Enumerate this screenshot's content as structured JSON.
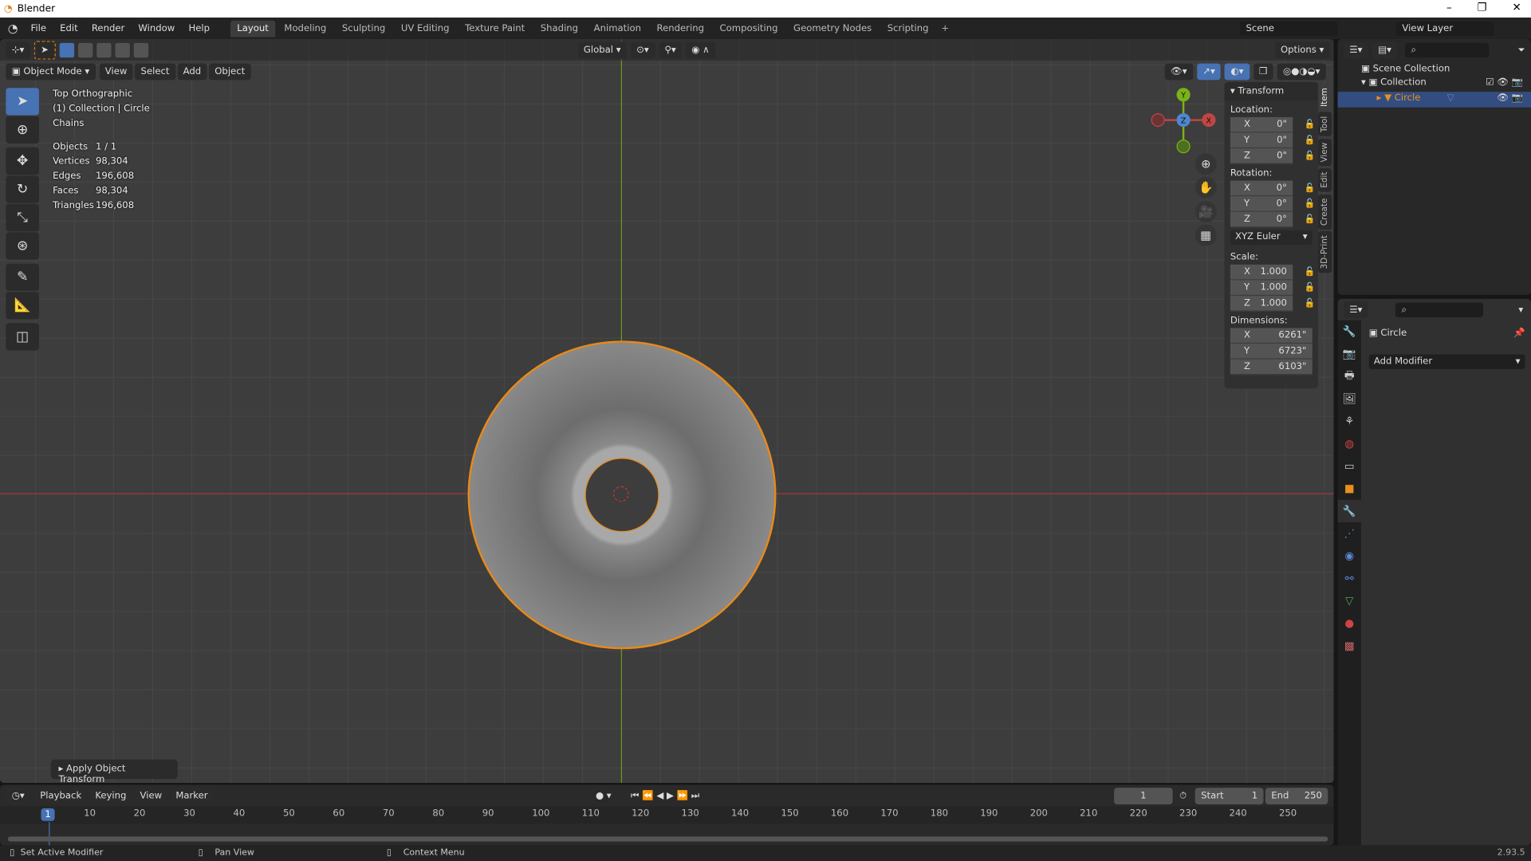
{
  "window": {
    "title": "Blender"
  },
  "menu": [
    "File",
    "Edit",
    "Render",
    "Window",
    "Help"
  ],
  "workspaces": [
    "Layout",
    "Modeling",
    "Sculpting",
    "UV Editing",
    "Texture Paint",
    "Shading",
    "Animation",
    "Rendering",
    "Compositing",
    "Geometry Nodes",
    "Scripting"
  ],
  "active_workspace": "Layout",
  "scene": "Scene",
  "view_layer": "View Layer",
  "tool_header": {
    "orientation": "Global",
    "options": "Options"
  },
  "viewport_header": {
    "mode": "Object Mode",
    "menus": [
      "View",
      "Select",
      "Add",
      "Object"
    ]
  },
  "overlay": {
    "view": "Top Orthographic",
    "collection": "(1) Collection | Circle",
    "extra": "Chains",
    "stats": [
      [
        "Objects",
        "1 / 1"
      ],
      [
        "Vertices",
        "98,304"
      ],
      [
        "Edges",
        "196,608"
      ],
      [
        "Faces",
        "98,304"
      ],
      [
        "Triangles",
        "196,608"
      ]
    ]
  },
  "gizmo": {
    "y": "Y",
    "z": "Z",
    "x": "X"
  },
  "transform": {
    "title": "Transform",
    "location_label": "Location:",
    "rotation_label": "Rotation:",
    "scale_label": "Scale:",
    "dimensions_label": "Dimensions:",
    "location": [
      [
        "X",
        "0\""
      ],
      [
        "Y",
        "0\""
      ],
      [
        "Z",
        "0\""
      ]
    ],
    "rotation": [
      [
        "X",
        "0°"
      ],
      [
        "Y",
        "0°"
      ],
      [
        "Z",
        "0°"
      ]
    ],
    "rotation_mode": "XYZ Euler",
    "scale": [
      [
        "X",
        "1.000"
      ],
      [
        "Y",
        "1.000"
      ],
      [
        "Z",
        "1.000"
      ]
    ],
    "dimensions": [
      [
        "X",
        "6261\""
      ],
      [
        "Y",
        "6723\""
      ],
      [
        "Z",
        "6103\""
      ]
    ]
  },
  "sidebar_tabs": [
    "Item",
    "Tool",
    "View",
    "Edit",
    "Create",
    "3D-Print"
  ],
  "operator_panel": "Apply Object Transform",
  "outliner": {
    "scene_collection": "Scene Collection",
    "collection": "Collection",
    "object": "Circle"
  },
  "properties": {
    "object": "Circle",
    "add_modifier": "Add Modifier"
  },
  "timeline": {
    "menus": [
      "Playback",
      "Keying",
      "View",
      "Marker"
    ],
    "current_frame": "1",
    "start_label": "Start",
    "start": "1",
    "end_label": "End",
    "end": "250",
    "ticks": [
      "1",
      "10",
      "20",
      "30",
      "40",
      "50",
      "60",
      "70",
      "80",
      "90",
      "100",
      "110",
      "120",
      "130",
      "140",
      "150",
      "160",
      "170",
      "180",
      "190",
      "200",
      "210",
      "220",
      "230",
      "240",
      "250"
    ]
  },
  "status": {
    "left": "Set Active Modifier",
    "middle": "Pan View",
    "right": "Context Menu",
    "version": "2.93.5"
  },
  "colors": {
    "accent": "#4772b3",
    "selection": "#e87d0d",
    "x_axis": "#c24545",
    "y_axis": "#7ab317",
    "z_axis": "#4f86d0"
  }
}
